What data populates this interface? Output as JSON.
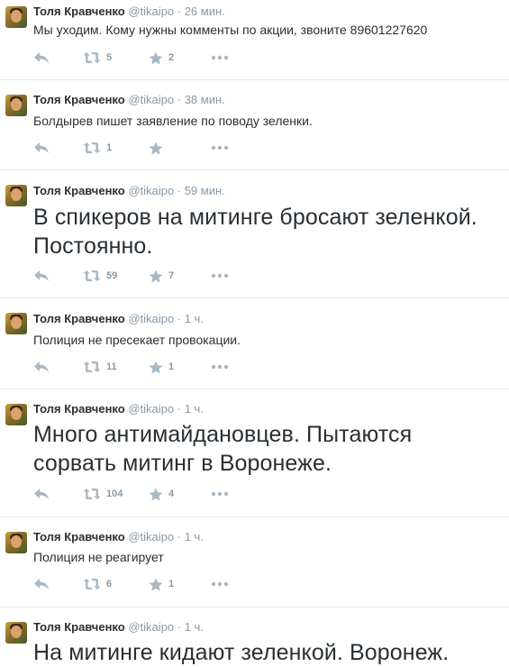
{
  "tweets": [
    {
      "name": "Толя Кравченко",
      "handle": "@tikaipo",
      "sep": "·",
      "time": "26 мин.",
      "lines": [
        "Мы уходим. Кому нужны комменты по акции, звоните 89601227620"
      ],
      "retweets": "5",
      "favorites": "2"
    },
    {
      "name": "Толя Кравченко",
      "handle": "@tikaipo",
      "sep": "·",
      "time": "38 мин.",
      "lines": [
        "Болдырев пишет заявление по поводу зеленки."
      ],
      "retweets": "1",
      "favorites": ""
    },
    {
      "name": "Толя Кравченко",
      "handle": "@tikaipo",
      "sep": "·",
      "time": "59 мин.",
      "lines": [
        "В спикеров на митинге бросают зеленкой.",
        "Постоянно."
      ],
      "retweets": "59",
      "favorites": "7"
    },
    {
      "name": "Толя Кравченко",
      "handle": "@tikaipo",
      "sep": "·",
      "time": "1 ч.",
      "lines": [
        "Полиция не пресекает провокации."
      ],
      "retweets": "11",
      "favorites": "1"
    },
    {
      "name": "Толя Кравченко",
      "handle": "@tikaipo",
      "sep": "·",
      "time": "1 ч.",
      "lines": [
        "Много антимайдановцев. Пытаются",
        "сорвать митинг в Воронеже."
      ],
      "retweets": "104",
      "favorites": "4"
    },
    {
      "name": "Толя Кравченко",
      "handle": "@tikaipo",
      "sep": "·",
      "time": "1 ч.",
      "lines": [
        "Полиция не реагирует"
      ],
      "retweets": "6",
      "favorites": "1"
    },
    {
      "name": "Толя Кравченко",
      "handle": "@tikaipo",
      "sep": "·",
      "time": "1 ч.",
      "lines": [
        "На митинге кидают зеленкой. Воронеж."
      ],
      "retweets": "",
      "favorites": ""
    }
  ],
  "icons": {
    "reply": "reply-icon",
    "retweet": "retweet-icon",
    "favorite": "star-icon",
    "more": "more-icon"
  },
  "colors": {
    "text": "#292f33",
    "meta": "#8899a6",
    "divider": "#e1e8ed"
  }
}
